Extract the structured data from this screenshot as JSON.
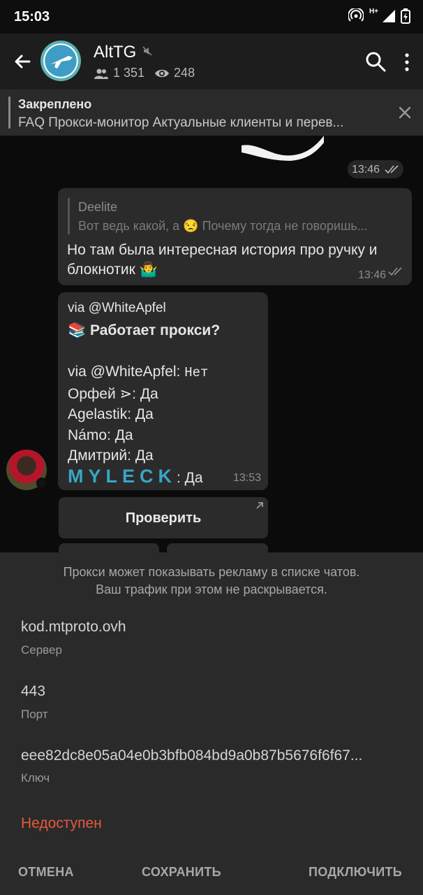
{
  "status_bar": {
    "time": "15:03",
    "network": "H+"
  },
  "header": {
    "title": "AltTG",
    "members": "1 351",
    "online": "248"
  },
  "pinned": {
    "title": "Закреплено",
    "text": "FAQ  Прокси-монитор  Актуальные клиенты и перев..."
  },
  "chat": {
    "time_chip": "13:46",
    "message1": {
      "reply_name": "Deelite",
      "reply_text": "Вот ведь какой, а 😒 Почему тогда не говоришь...",
      "text": "Но там была интересная история про ручку и блокнотик 🤷‍♂️",
      "time": "13:46"
    },
    "message2": {
      "via": "via @WhiteApfel",
      "poll_title": "📚 Работает прокси?",
      "results": [
        {
          "name": "via @WhiteApfel",
          "value": "Нет",
          "mono": true
        },
        {
          "name": "Орфей ⋗",
          "value": "Да"
        },
        {
          "name": "Agelastik",
          "value": "Да"
        },
        {
          "name": "Námo",
          "value": "Да"
        },
        {
          "name": "Дмитрий",
          "value": "Да"
        },
        {
          "name": "MYLECK",
          "value": "Да",
          "styled": true
        }
      ],
      "time": "13:53"
    },
    "check_button": "Проверить"
  },
  "proxy_sheet": {
    "notice_line1": "Прокси может показывать рекламу в списке чатов.",
    "notice_line2": "Ваш трафик при этом не раскрывается.",
    "server_value": "kod.mtproto.ovh",
    "server_label": "Сервер",
    "port_value": "443",
    "port_label": "Порт",
    "key_value": "eee82dc8e05a04e0b3bfb084bd9a0b87b5676f6f67...",
    "key_label": "Ключ",
    "status": "Недоступен",
    "cancel": "ОТМЕНА",
    "save": "СОХРАНИТЬ",
    "connect": "ПОДКЛЮЧИТЬ",
    "status_color": "#e8593c"
  }
}
